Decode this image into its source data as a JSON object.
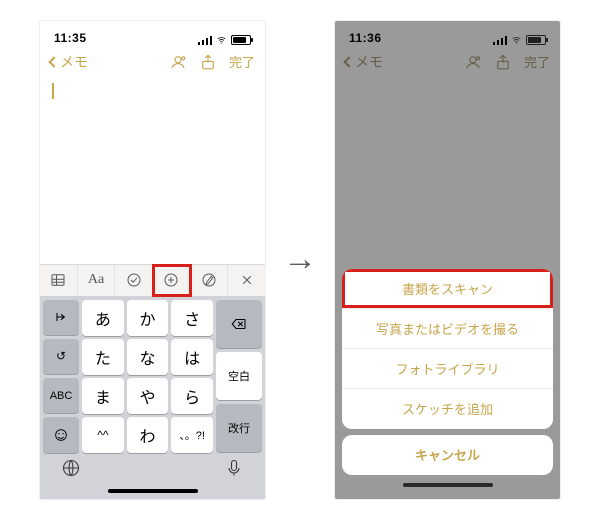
{
  "status": {
    "time_left": "11:35",
    "time_right": "11:36"
  },
  "nav": {
    "back_label": "メモ",
    "done_label": "完了"
  },
  "kbd_toolbar": {
    "font": "Aa"
  },
  "keys": {
    "r1": [
      "あ",
      "か",
      "さ"
    ],
    "r2": [
      "た",
      "な",
      "は"
    ],
    "r3": [
      "ま",
      "や",
      "ら"
    ],
    "r4": [
      "^^",
      "わ",
      "、。?!"
    ],
    "left": [
      "→",
      "↺",
      "ABC"
    ],
    "right": [
      "⌫",
      "空白",
      "改行"
    ]
  },
  "sheet": {
    "items": [
      "書類をスキャン",
      "写真またはビデオを撮る",
      "フォトライブラリ",
      "スケッチを追加"
    ],
    "cancel": "キャンセル"
  }
}
